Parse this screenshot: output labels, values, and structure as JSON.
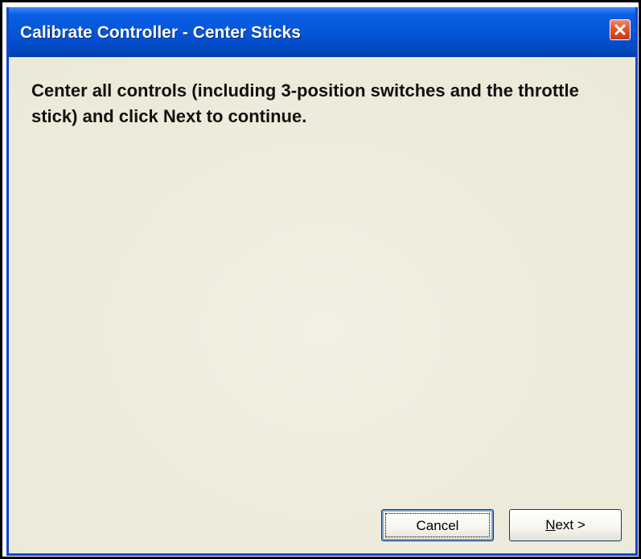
{
  "window": {
    "title": "Calibrate Controller - Center Sticks"
  },
  "titlebar_icons": {
    "close": "close-icon"
  },
  "main": {
    "instructions": "Center all controls (including 3-position switches and the throttle stick) and click Next to continue."
  },
  "buttons": {
    "cancel_label": "Cancel",
    "next_label": "Next >"
  },
  "colors": {
    "titlebar": "#0556d8",
    "window_frame": "#0a46d0",
    "client_background": "#ece9d8",
    "close_button": "#e2552e"
  }
}
